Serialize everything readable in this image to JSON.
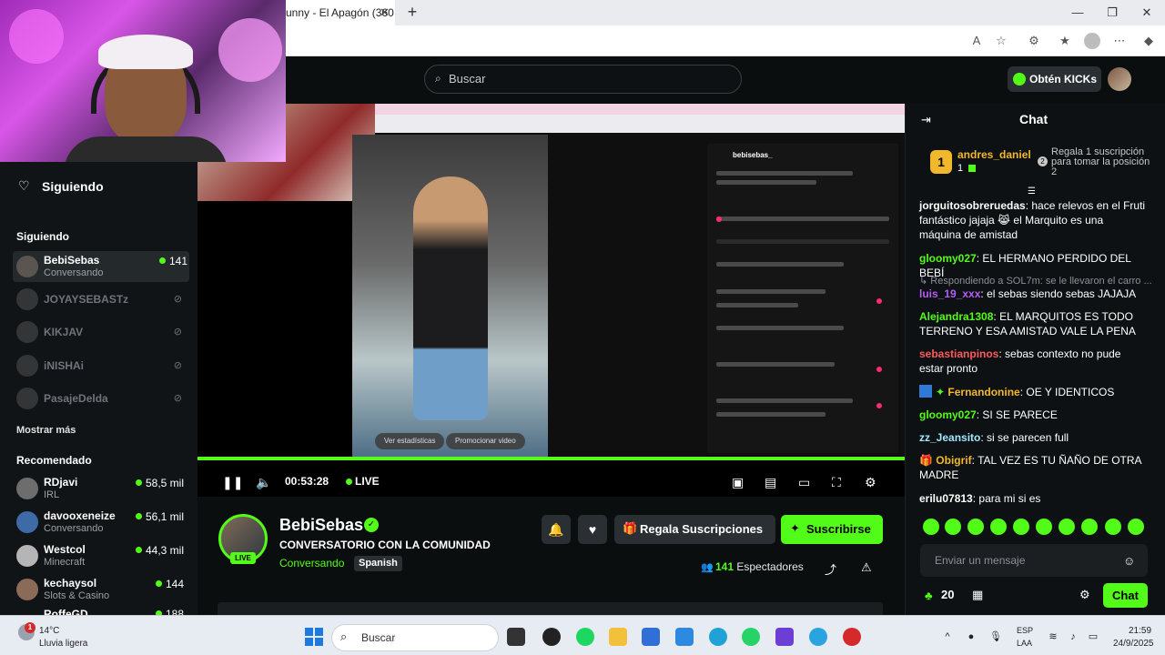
{
  "browser": {
    "tab_title": "unny - El Apagón (360",
    "tab_close": "✕",
    "new_tab": "+"
  },
  "header": {
    "search_placeholder": "Buscar",
    "kicks_button": "Obtén KICKs"
  },
  "sidebar": {
    "following_nav": "Siguiendo",
    "following_heading": "Siguiendo",
    "following": [
      {
        "name": "BebiSebas",
        "sub": "Conversando",
        "viewers": "141",
        "online": true
      },
      {
        "name": "JOYAYSEBASTz",
        "online": false
      },
      {
        "name": "KIKJAV",
        "online": false
      },
      {
        "name": "iNISHAi",
        "online": false
      },
      {
        "name": "PasajeDelda",
        "online": false
      }
    ],
    "show_more": "Mostrar más",
    "recommended_heading": "Recomendado",
    "recommended": [
      {
        "name": "RDjavi",
        "sub": "IRL",
        "viewers": "58,5 mil"
      },
      {
        "name": "davooxeneize",
        "sub": "Conversando",
        "viewers": "56,1 mil"
      },
      {
        "name": "Westcol",
        "sub": "Minecraft",
        "viewers": "44,3 mil"
      },
      {
        "name": "kechaysol",
        "sub": "Slots & Casino",
        "viewers": "144"
      },
      {
        "name": "RoffeGD",
        "sub": "",
        "viewers": "188"
      }
    ]
  },
  "video": {
    "btn_stats": "Ver estadísticas",
    "btn_promote": "Promocionar video",
    "tiktok_user": "bebisebas_",
    "time": "00:53:28",
    "live": "LIVE"
  },
  "channel": {
    "name": "BebiSebas",
    "live_badge": "LIVE",
    "title": "CONVERSATORIO CON LA COMUNIDAD",
    "category": "Conversando",
    "language": "Spanish",
    "gift_subs": "Regala Suscripciones",
    "subscribe": "Suscribirse",
    "viewers_count": "141",
    "viewers_label": "Espectadores"
  },
  "chat": {
    "title": "Chat",
    "top_rank": "1",
    "top_user": "andres_daniel",
    "top_count": "1",
    "gift_info": "Regala 1 suscripción para tomar la posición 2",
    "messages": [
      {
        "user": "jorguitosobreruedas",
        "color": "#f4f4f4",
        "text": "hace relevos en el Fruti fantástico jajaja 😹 el Marquito es una máquina de amistad"
      },
      {
        "user": "gloomy027",
        "color": "#53fc18",
        "text": "EL HERMANO PERDIDO DEL BEBÍ"
      },
      {
        "user": "luis_19_xxx",
        "color": "#b65cf7",
        "text": "el sebas siendo sebas JAJAJA"
      },
      {
        "user": "Alejandra1308",
        "color": "#53fc18",
        "text": "EL MARQUITOS ES TODO TERRENO Y ESA AMISTAD VALE LA PENA"
      },
      {
        "user": "sebastianpinos",
        "color": "#ff5a5a",
        "text": "sebas contexto no pude estar pronto"
      },
      {
        "user": "Fernandonine",
        "color": "#f1b82b",
        "text": "OE Y IDENTICOS"
      },
      {
        "user": "gloomy027",
        "color": "#53fc18",
        "text": "SI SE PARECE"
      },
      {
        "user": "zz_Jeansito",
        "color": "#9fe8ff",
        "text": "si se parecen full"
      },
      {
        "user": "Obigrif",
        "color": "#f1b82b",
        "text": "TAL VEZ ES TU ÑAÑO DE OTRA MADRE"
      },
      {
        "user": "erilu07813",
        "color": "#f4f4f4",
        "text": "para mi si es"
      }
    ],
    "reply_text": "Respondiendo a SOL7m: se le llevaron el carro ...",
    "input_placeholder": "Enviar un mensaje",
    "points": "20",
    "chat_button": "Chat"
  },
  "taskbar": {
    "temperature": "14°C",
    "weather": "Lluvia ligera",
    "weather_badge": "1",
    "search": "Buscar",
    "lang_line1": "ESP",
    "lang_line2": "LAA",
    "time": "21:59",
    "date": "24/9/2025"
  }
}
